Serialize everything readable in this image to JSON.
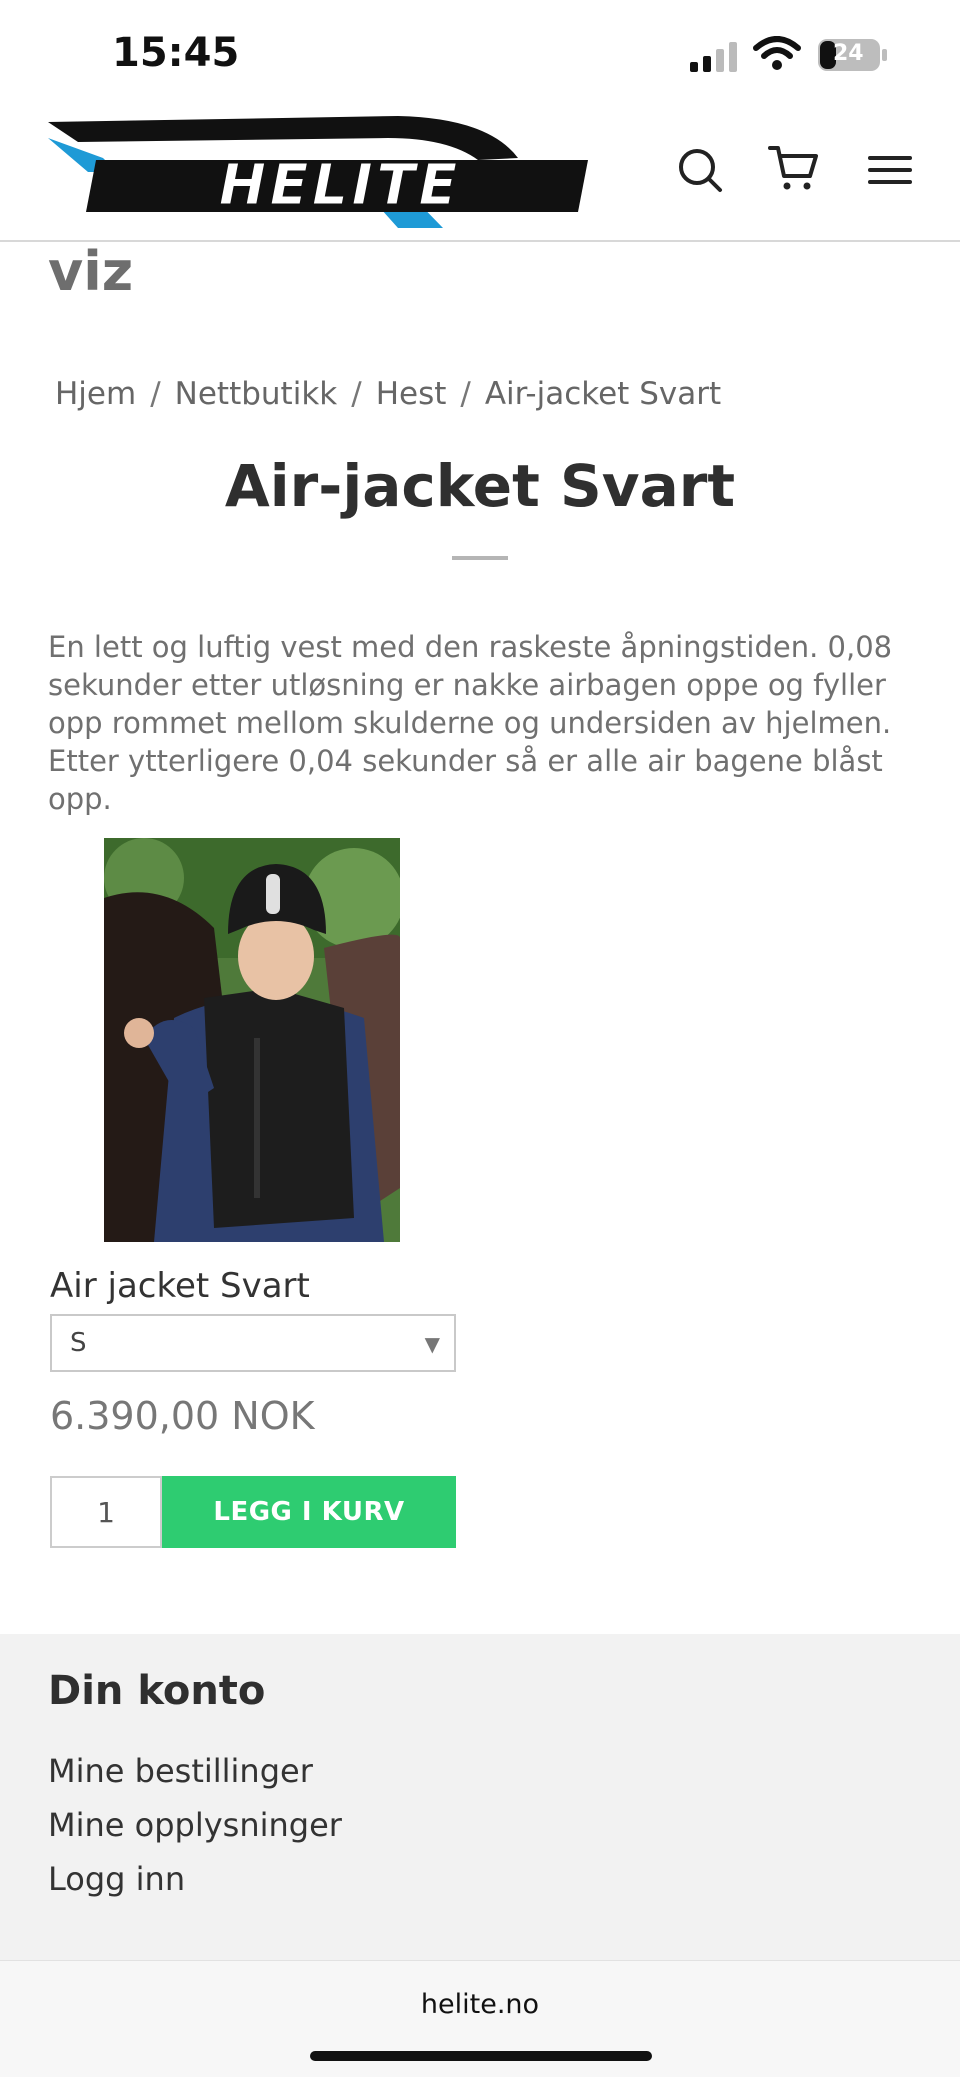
{
  "status_bar": {
    "time": "15:45",
    "battery": "24"
  },
  "header": {
    "logo_text": "HELITE",
    "icons": [
      "search-icon",
      "cart-icon",
      "menu-icon"
    ]
  },
  "viz_text": "viz",
  "breadcrumb": {
    "items": [
      "Hjem",
      "Nettbutikk",
      "Hest",
      "Air-jacket Svart"
    ],
    "separator": "/"
  },
  "product": {
    "title": "Air-jacket Svart",
    "description": "En lett og luftig vest med den raskeste åpningstiden. 0,08 sekunder etter utløsning er nakke airbagen oppe og fyller opp rommet mellom skulderne og undersiden av hjelmen. Etter ytterligere 0,04 sekunder så er alle air bagene blåst opp.",
    "variant_label": "Air jacket Svart",
    "variant_selected": "S",
    "price": "6.390,00 NOK",
    "quantity": "1",
    "add_to_cart_label": "LEGG I KURV"
  },
  "account": {
    "title": "Din konto",
    "links": [
      "Mine bestillinger",
      "Mine opplysninger",
      "Logg inn"
    ]
  },
  "browser": {
    "url": "helite.no"
  },
  "colors": {
    "accent_green": "#2ecc71",
    "logo_blue": "#1e9ad6"
  }
}
